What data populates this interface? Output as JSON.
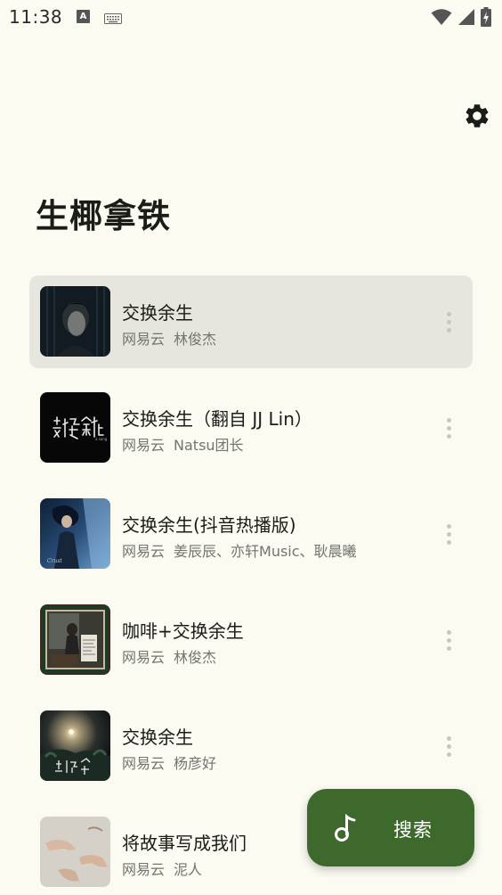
{
  "status_bar": {
    "time": "11:38",
    "icons": [
      "a-notification-icon",
      "keyboard-icon",
      "wifi-icon",
      "signal-icon",
      "battery-charging-icon"
    ]
  },
  "header": {
    "title": "生椰拿铁",
    "settings_icon": "gear-icon"
  },
  "songs": [
    {
      "title": "交换余生",
      "source": "网易云",
      "artist": "林俊杰",
      "selected": true
    },
    {
      "title": "交换余生（翻自 JJ Lin）",
      "source": "网易云",
      "artist": "Natsu团长",
      "selected": false
    },
    {
      "title": "交换余生(抖音热播版)",
      "source": "网易云",
      "artist": "姜辰辰、亦轩Music、耿晨曦",
      "selected": false
    },
    {
      "title": "咖啡+交换余生",
      "source": "网易云",
      "artist": "林俊杰",
      "selected": false
    },
    {
      "title": "交换余生",
      "source": "网易云",
      "artist": "杨彦好",
      "selected": false
    },
    {
      "title": "将故事写成我们",
      "source": "网易云",
      "artist": "泥人",
      "selected": false
    }
  ],
  "fab": {
    "label": "搜索",
    "icon": "music-note-icon"
  },
  "colors": {
    "background": "#fbfbf2",
    "selected_row": "#e6e6de",
    "fab": "#3d6a2c",
    "meta_text": "#73766e"
  }
}
